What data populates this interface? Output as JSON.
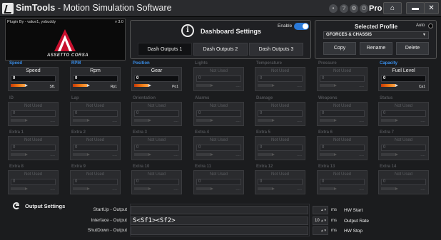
{
  "titlebar": {
    "brand": "SimTools",
    "subtitle": " - Motion Simulation Software",
    "edition": "Pro",
    "home_icon": "home-icon",
    "min_icon": "minimize-icon",
    "close_icon": "close-icon"
  },
  "game": {
    "plugin_label": "Plugin By - value1, yobuddy",
    "version": "v 3.0",
    "logo_text": "ASSETTO CORSA"
  },
  "dashboard": {
    "title": "Dashboard Settings",
    "enable_label": "Enable",
    "enabled": true,
    "tabs": [
      "Dash Outputs 1",
      "Dash Outputs 2",
      "Dash Outputs 3"
    ],
    "active_tab": 0
  },
  "profile": {
    "title": "Selected Profile",
    "auto_label": "Auto",
    "selected": "GFORCES & CHASSIS",
    "buttons": [
      "Copy",
      "Rename",
      "Delete"
    ]
  },
  "cells": [
    {
      "label": "Speed",
      "name": "Speed",
      "value": "0",
      "code": "Sf1",
      "active": true
    },
    {
      "label": "RPM",
      "name": "Rpm",
      "value": "0",
      "code": "Rp1",
      "active": true
    },
    {
      "label": "Position",
      "name": "Gear",
      "value": "0",
      "code": "Po1",
      "active": true
    },
    {
      "label": "Lights",
      "name": "Not Used",
      "value": "0",
      "code": "----",
      "active": false
    },
    {
      "label": "Temperature",
      "name": "Not Used",
      "value": "0",
      "code": "----",
      "active": false
    },
    {
      "label": "Pressure",
      "name": "Not Used",
      "value": "0",
      "code": "----",
      "active": false
    },
    {
      "label": "Capacity",
      "name": "Fuel Level",
      "value": "0",
      "code": "Ca1",
      "active": true
    },
    {
      "label": "ID",
      "name": "Not Used",
      "value": "0",
      "code": "----",
      "active": false
    },
    {
      "label": "Lap",
      "name": "Not Used",
      "value": "0",
      "code": "----",
      "active": false
    },
    {
      "label": "Orientation",
      "name": "Not Used",
      "value": "0",
      "code": "----",
      "active": false
    },
    {
      "label": "Alarms",
      "name": "Not Used",
      "value": "0",
      "code": "----",
      "active": false
    },
    {
      "label": "Damage",
      "name": "Not Used",
      "value": "0",
      "code": "----",
      "active": false
    },
    {
      "label": "Weapons",
      "name": "Not Used",
      "value": "0",
      "code": "----",
      "active": false
    },
    {
      "label": "Status",
      "name": "Not Used",
      "value": "0",
      "code": "----",
      "active": false
    },
    {
      "label": "Extra 1",
      "name": "Not Used",
      "value": "0",
      "code": "----",
      "active": false
    },
    {
      "label": "Extra 2",
      "name": "Not Used",
      "value": "0",
      "code": "----",
      "active": false
    },
    {
      "label": "Extra 3",
      "name": "Not Used",
      "value": "0",
      "code": "----",
      "active": false
    },
    {
      "label": "Extra 4",
      "name": "Not Used",
      "value": "0",
      "code": "----",
      "active": false
    },
    {
      "label": "Extra 5",
      "name": "Not Used",
      "value": "0",
      "code": "----",
      "active": false
    },
    {
      "label": "Extra 6",
      "name": "Not Used",
      "value": "0",
      "code": "----",
      "active": false
    },
    {
      "label": "Extra 7",
      "name": "Not Used",
      "value": "0",
      "code": "----",
      "active": false
    },
    {
      "label": "Extra 8",
      "name": "Not Used",
      "value": "0",
      "code": "----",
      "active": false
    },
    {
      "label": "Extra 9",
      "name": "Not Used",
      "value": "0",
      "code": "----",
      "active": false
    },
    {
      "label": "Extra 10",
      "name": "Not Used",
      "value": "0",
      "code": "----",
      "active": false
    },
    {
      "label": "Extra 11",
      "name": "Not Used",
      "value": "0",
      "code": "----",
      "active": false
    },
    {
      "label": "Extra 12",
      "name": "Not Used",
      "value": "0",
      "code": "----",
      "active": false
    },
    {
      "label": "Extra 13",
      "name": "Not Used",
      "value": "0",
      "code": "----",
      "active": false
    },
    {
      "label": "Extra 14",
      "name": "Not Used",
      "value": "0",
      "code": "----",
      "active": false
    }
  ],
  "output": {
    "title": "Output Settings",
    "rows": [
      {
        "label": "StartUp - Output",
        "value": "",
        "ms_value": "",
        "unit": "ms",
        "side_label": "HW Start"
      },
      {
        "label": "Interface - Output",
        "value": "S<Sf1><Sf2>",
        "ms_value": "10",
        "unit": "ms",
        "side_label": "Output Rate"
      },
      {
        "label": "ShutDown - Output",
        "value": "",
        "ms_value": "",
        "unit": "ms",
        "side_label": "HW Stop"
      }
    ]
  },
  "colors": {
    "accent": "#2a79d8",
    "active_label": "#3a8ee8",
    "background": "#1b1c1e"
  }
}
